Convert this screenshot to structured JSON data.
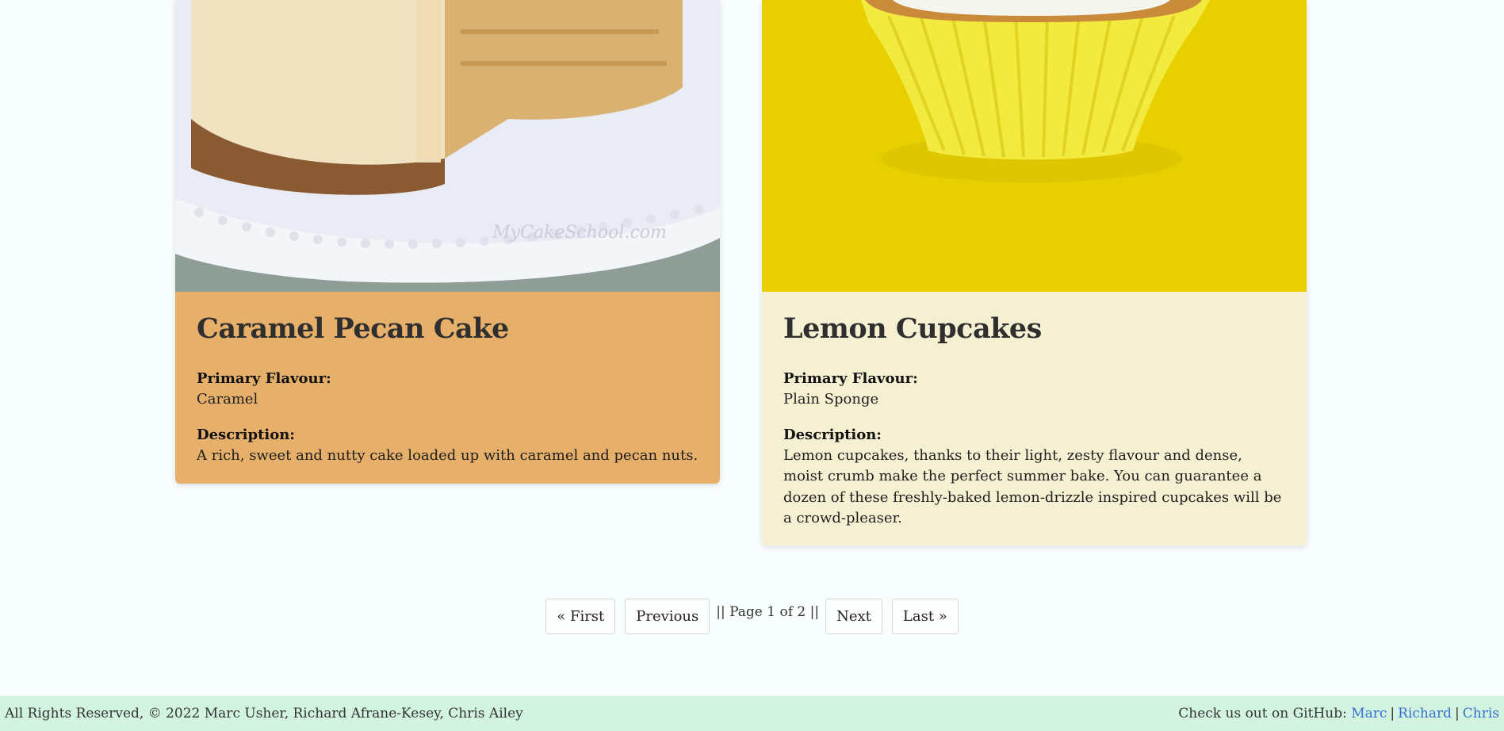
{
  "cards": [
    {
      "title": "Caramel Pecan Cake",
      "flavour_label": "Primary Flavour:",
      "flavour": "Caramel",
      "description_label": "Description:",
      "description": "A rich, sweet and nutty cake loaded up with caramel and pecan nuts.",
      "image_watermark": "MyCakeSchool.com"
    },
    {
      "title": "Lemon Cupcakes",
      "flavour_label": "Primary Flavour:",
      "flavour": "Plain Sponge",
      "description_label": "Description:",
      "description": "Lemon cupcakes, thanks to their light, zesty flavour and dense, moist crumb make the perfect summer bake. You can guarantee a dozen of these freshly-baked lemon-drizzle inspired cupcakes will be a crowd-pleaser."
    }
  ],
  "pagination": {
    "first": "« First",
    "previous": "Previous",
    "info": "|| Page 1 of 2 ||",
    "next": "Next",
    "last": "Last »"
  },
  "footer": {
    "copyright": "All Rights Reserved, © 2022 Marc Usher, Richard Afrane-Kesey, Chris Ailey",
    "github_prefix": "Check us out on GitHub:",
    "links": [
      "Marc",
      "Richard",
      "Chris"
    ],
    "separator": "|"
  },
  "colors": {
    "card1_bg": "#e7b06a",
    "card2_bg": "#f5f0d2",
    "footer_bg": "#d1f3df",
    "link": "#3a6fd0"
  }
}
